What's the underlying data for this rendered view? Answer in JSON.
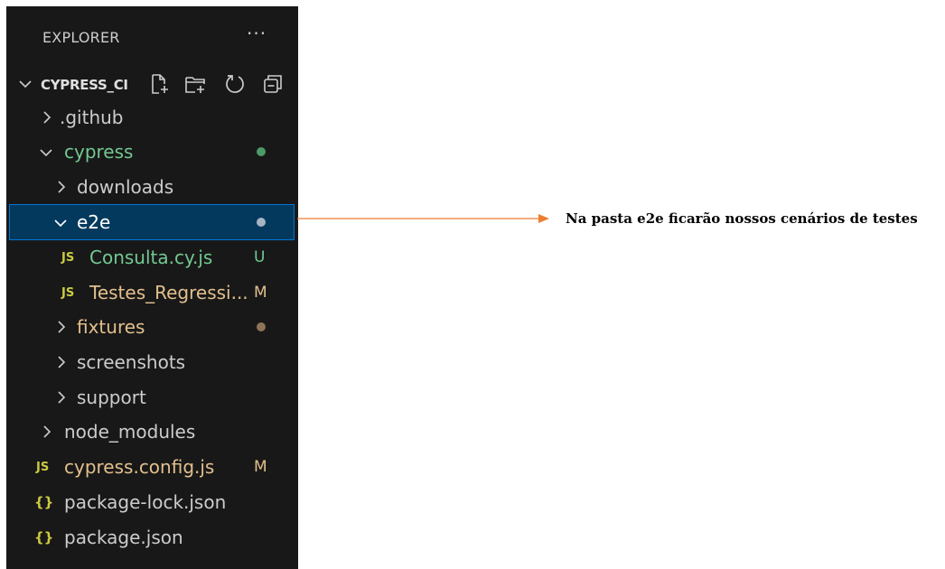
{
  "explorer": {
    "title": "EXPLORER",
    "more": "···",
    "section_title": "CYPRESS_CI",
    "actions": [
      "new-file-icon",
      "new-folder-icon",
      "refresh-icon",
      "collapse-all-icon"
    ]
  },
  "tree": {
    "github": "github",
    "github_prefix": ".",
    "cypress": "cypress",
    "downloads": "downloads",
    "e2e": "e2e",
    "consulta": "Consulta.cy.js",
    "consulta_badge": "U",
    "testes": "Testes_Regressi...",
    "testes_badge": "M",
    "fixtures": "fixtures",
    "screenshots": "screenshots",
    "support": "support",
    "node_modules": "node_modules",
    "config": "cypress.config.js",
    "config_badge": "M",
    "package_lock": "package-lock.json",
    "package": "package.json",
    "js_icon": "JS",
    "json_icon": "{}"
  },
  "colors": {
    "untracked": "#73c991",
    "modified": "#e2c08d",
    "selection": "#04395e",
    "arrow": "#ed7d31"
  },
  "annotation": "Na pasta e2e ficarão nossos cenários de testes"
}
